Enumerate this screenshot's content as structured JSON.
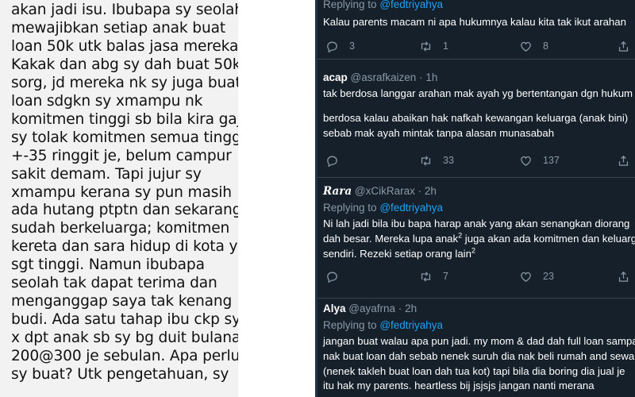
{
  "chat_message": {
    "lines": [
      "akan jadi isu. Ibubapa sy seolah",
      "mewajibkan setiap anak buat",
      "loan 50k utk balas jasa mereka.",
      "Kakak dan abg sy dah buat 50k",
      "sorg, jd mereka nk sy juga buat",
      "loan sdgkn sy xmampu nk",
      "komitmen tinggi sb bila kira gaji",
      "sy tolak komitmen semua tinggal",
      "+-35 ringgit je, belum campur",
      "sakit demam. Tapi jujur sy",
      "xmampu kerana sy pun masih",
      "ada hutang ptptn dan sekarang",
      "sudah berkeluarga; komitmen",
      "kereta dan sara hidup di kota yg",
      "sgt tinggi. Namun ibubapa",
      "seolah tak dapat terima dan",
      "menganggap saya tak kenang",
      "budi. Ada satu tahap ibu ckp sy",
      "x dpt anak sb sy bg duit bulanan",
      "200@300 je sebulan. Apa perlu",
      "sy buat? Utk pengetahuan, sy"
    ]
  },
  "tweets": [
    {
      "replying_label": "Replying to",
      "replying_to": "@fedtriyahya",
      "body": [
        "Kalau parents macam ni apa hukumnya kalau kita tak ikut arahan"
      ],
      "replies": "3",
      "retweets": "1",
      "likes": "8"
    },
    {
      "author": "acap",
      "handle": "@asrafkaizen",
      "sep": "·",
      "time": "1h",
      "body": [
        "tak berdosa langgar arahan mak ayah yg bertentangan dgn hukum",
        "berdosa kalau abaikan hak nafkah kewangan keluarga (anak bini)",
        "sebab mak ayah mintak tanpa alasan munasabah"
      ],
      "retweets": "33",
      "likes": "137"
    },
    {
      "author": "Rara",
      "handle": "@xCikRarax",
      "sep": "·",
      "time": "2h",
      "replying_label": "Replying to",
      "replying_to": "@fedtriyahya",
      "body_line1": "Ni lah jadi bila ibu bapa harap anak yang akan senangkan diorang",
      "body_line2_a": "dah besar. Mereka lupa anak",
      "body_line2_sup": "2",
      "body_line2_b": " juga akan ada komitmen dan keluarga",
      "body_line3_a": "sendiri. Rezeki setiap orang lain",
      "body_line3_sup": "2",
      "retweets": "7",
      "likes": "23"
    },
    {
      "author": "Alya",
      "handle": "@ayafrna",
      "sep": "·",
      "time": "2h",
      "replying_label": "Replying to",
      "replying_to": "@fedtriyahya",
      "body": [
        "jangan buat walau apa pun jadi. my mom & dad dah full loan sampai",
        "nak buat loan dah sebab nenek suruh dia nak beli rumah and sewa",
        "(nenek takleh buat loan dah tua kot) tapi bila dia boring dia jual je",
        "itu hak my parents. heartless bij jsjsjs jangan nanti merana"
      ]
    }
  ],
  "icons": {
    "reply": "reply-icon",
    "retweet": "retweet-icon",
    "like": "heart-icon",
    "share": "share-icon"
  },
  "colors": {
    "twitter_dark_bg": "#15202b",
    "link_blue": "#1da1f2",
    "muted_text": "#8899a6",
    "divider": "#38444d",
    "chat_bg": "#f2f2f2"
  }
}
